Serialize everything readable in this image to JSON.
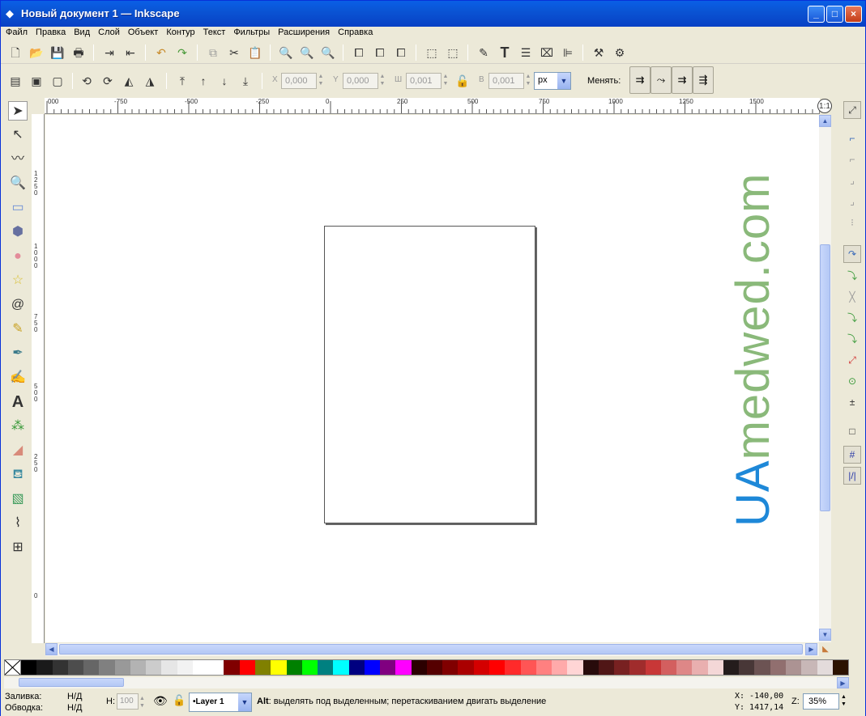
{
  "window": {
    "title": "Новый документ 1 — Inkscape",
    "minimize": "_",
    "maximize": "□",
    "close": "×"
  },
  "menu": [
    "Файл",
    "Правка",
    "Вид",
    "Слой",
    "Объект",
    "Контур",
    "Текст",
    "Фильтры",
    "Расширения",
    "Справка"
  ],
  "controls": {
    "x_label": "X",
    "x_value": "0,000",
    "y_label": "Y",
    "y_value": "0,000",
    "w_label": "Ш",
    "w_value": "0,001",
    "h_label": "В",
    "h_value": "0,001",
    "unit": "px",
    "change_label": "Менять:"
  },
  "rulers": {
    "h_ticks": [
      "000",
      "-750",
      "-500",
      "-250",
      "0",
      "250",
      "500",
      "750",
      "1000",
      "1250",
      "1500"
    ],
    "v_ticks": [
      "1250",
      "1000",
      "750",
      "500",
      "250",
      "0"
    ]
  },
  "watermark": {
    "ua": "UA",
    "rest": "medwed.com"
  },
  "palette": [
    "#000000",
    "#1a1a1a",
    "#333333",
    "#4d4d4d",
    "#666666",
    "#808080",
    "#999999",
    "#b3b3b3",
    "#cccccc",
    "#e6e6e6",
    "#f2f2f2",
    "#ffffff",
    "#ffffff",
    "#800000",
    "#ff0000",
    "#808000",
    "#ffff00",
    "#008000",
    "#00ff00",
    "#008080",
    "#00ffff",
    "#000080",
    "#0000ff",
    "#800080",
    "#ff00ff",
    "#2b0000",
    "#550000",
    "#800000",
    "#aa0000",
    "#d40000",
    "#ff0000",
    "#ff2a2a",
    "#ff5555",
    "#ff8080",
    "#ffaaaa",
    "#ffd5d5",
    "#280b0b",
    "#501616",
    "#782121",
    "#a02c2c",
    "#c83737",
    "#d35f5f",
    "#de8787",
    "#e9afaf",
    "#f4d7d7",
    "#241c1c",
    "#483737",
    "#6c5353",
    "#916f6f",
    "#ac9393",
    "#c8b7b7",
    "#e3dbdb",
    "#2b1100"
  ],
  "status": {
    "fill_label": "Заливка:",
    "fill_value": "Н/Д",
    "stroke_label": "Обводка:",
    "stroke_value": "Н/Д",
    "h_label": "Н:",
    "h_value": "100",
    "layer": "•Layer 1",
    "message_key": "Alt",
    "message_text": ": выделять под выделенным; перетаскиванием двигать выделение",
    "x_coord": "X: -140,00",
    "y_coord": "Y: 1417,14",
    "zoom_label": "Z:",
    "zoom_value": "35%"
  },
  "colors": {
    "titlebar": "#0a54d4",
    "chrome": "#ece9d8",
    "watermark_green": "#8ab97a",
    "watermark_blue": "#1e88d8"
  }
}
